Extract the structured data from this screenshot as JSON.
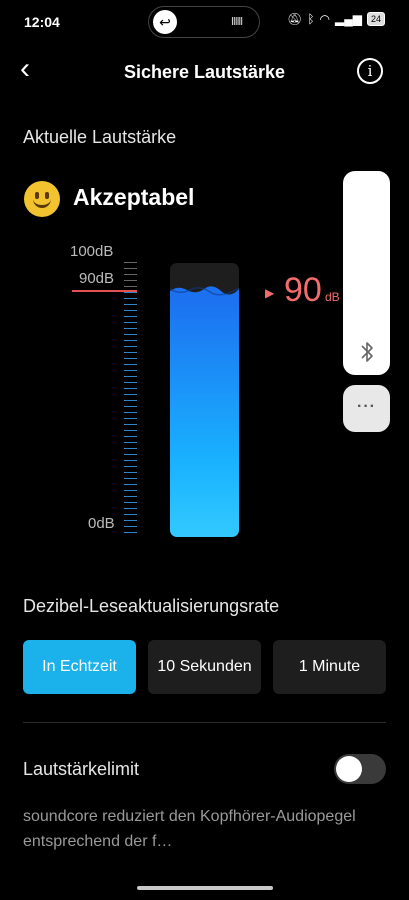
{
  "status_bar": {
    "time": "12:04",
    "battery": "24"
  },
  "header": {
    "title": "Sichere Lautstärke"
  },
  "current": {
    "label": "Aktuelle Lautstärke",
    "status": "Akzeptabel"
  },
  "meter": {
    "scale_top": "100dB",
    "scale_limit": "90dB",
    "scale_bottom": "0dB",
    "value": "90",
    "unit": "dB",
    "level_fraction": 0.9,
    "accent": "#1bb1ea",
    "warning_color": "#f26d6d"
  },
  "rate": {
    "label": "Dezibel-Leseaktualisierungsrate",
    "options": [
      "In Echtzeit",
      "10 Sekunden",
      "1 Minute"
    ],
    "selected": "In Echtzeit"
  },
  "limit": {
    "label": "Lautstärkelimit",
    "enabled": false,
    "description": "soundcore reduziert den Kopfhörer-Audiopegel entsprechend der f…"
  },
  "icons": {
    "back": "back-chevron-icon",
    "info": "info-icon",
    "bluetooth": "bluetooth-icon",
    "more": "more-icon"
  }
}
